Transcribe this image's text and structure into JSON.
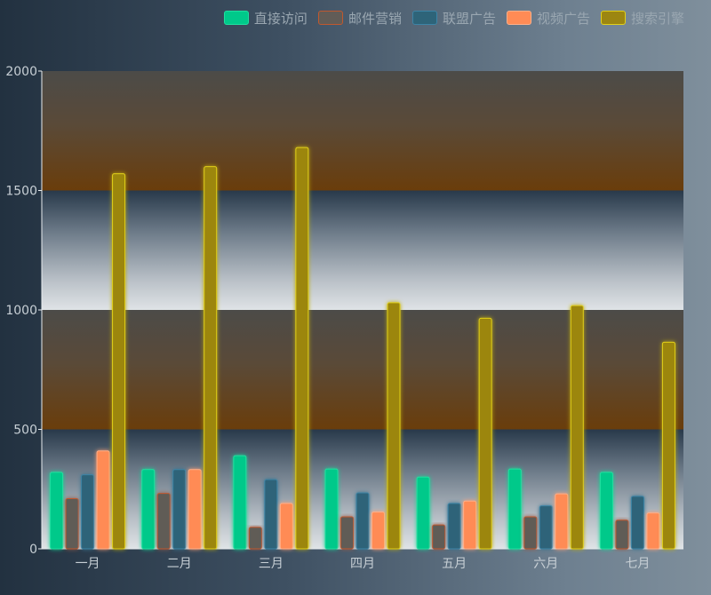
{
  "legend": {
    "items": [
      {
        "name": "直接访问",
        "color": "#00c98a",
        "border": "#20e0a0"
      },
      {
        "name": "邮件营销",
        "color": "#615c57",
        "border": "#c0582e"
      },
      {
        "name": "联盟广告",
        "color": "#2e6479",
        "border": "#3c84a6"
      },
      {
        "name": "视频广告",
        "color": "#ff8b55",
        "border": "#ffb08a"
      },
      {
        "name": "搜索引擎",
        "color": "#9c8611",
        "border": "#e1d018"
      }
    ]
  },
  "chart_data": {
    "type": "bar",
    "categories": [
      "一月",
      "二月",
      "三月",
      "四月",
      "五月",
      "六月",
      "七月"
    ],
    "series": [
      {
        "name": "直接访问",
        "values": [
          320,
          332,
          390,
          334,
          300,
          334,
          320
        ]
      },
      {
        "name": "邮件营销",
        "values": [
          210,
          232,
          90,
          134,
          100,
          134,
          120
        ]
      },
      {
        "name": "联盟广告",
        "values": [
          310,
          332,
          290,
          234,
          190,
          180,
          220
        ]
      },
      {
        "name": "视频广告",
        "values": [
          410,
          332,
          190,
          154,
          200,
          230,
          150
        ]
      },
      {
        "name": "搜索引擎",
        "values": [
          1570,
          1600,
          1680,
          1030,
          965,
          1018,
          865
        ]
      }
    ],
    "y_ticks": [
      "0",
      "500",
      "1000",
      "1500",
      "2000"
    ],
    "ylim": [
      0,
      2000
    ],
    "legend_position": "top-right",
    "colors": [
      "#00c98a",
      "#615c57",
      "#2e6479",
      "#ff8b55",
      "#9c8611"
    ],
    "background_bands": [
      {
        "from": 0,
        "to": 500,
        "style": "steel-gradient"
      },
      {
        "from": 500,
        "to": 1000,
        "style": "brown-gradient"
      },
      {
        "from": 1000,
        "to": 1500,
        "style": "steel-gradient"
      },
      {
        "from": 1500,
        "to": 2000,
        "style": "brown-gradient"
      }
    ]
  }
}
